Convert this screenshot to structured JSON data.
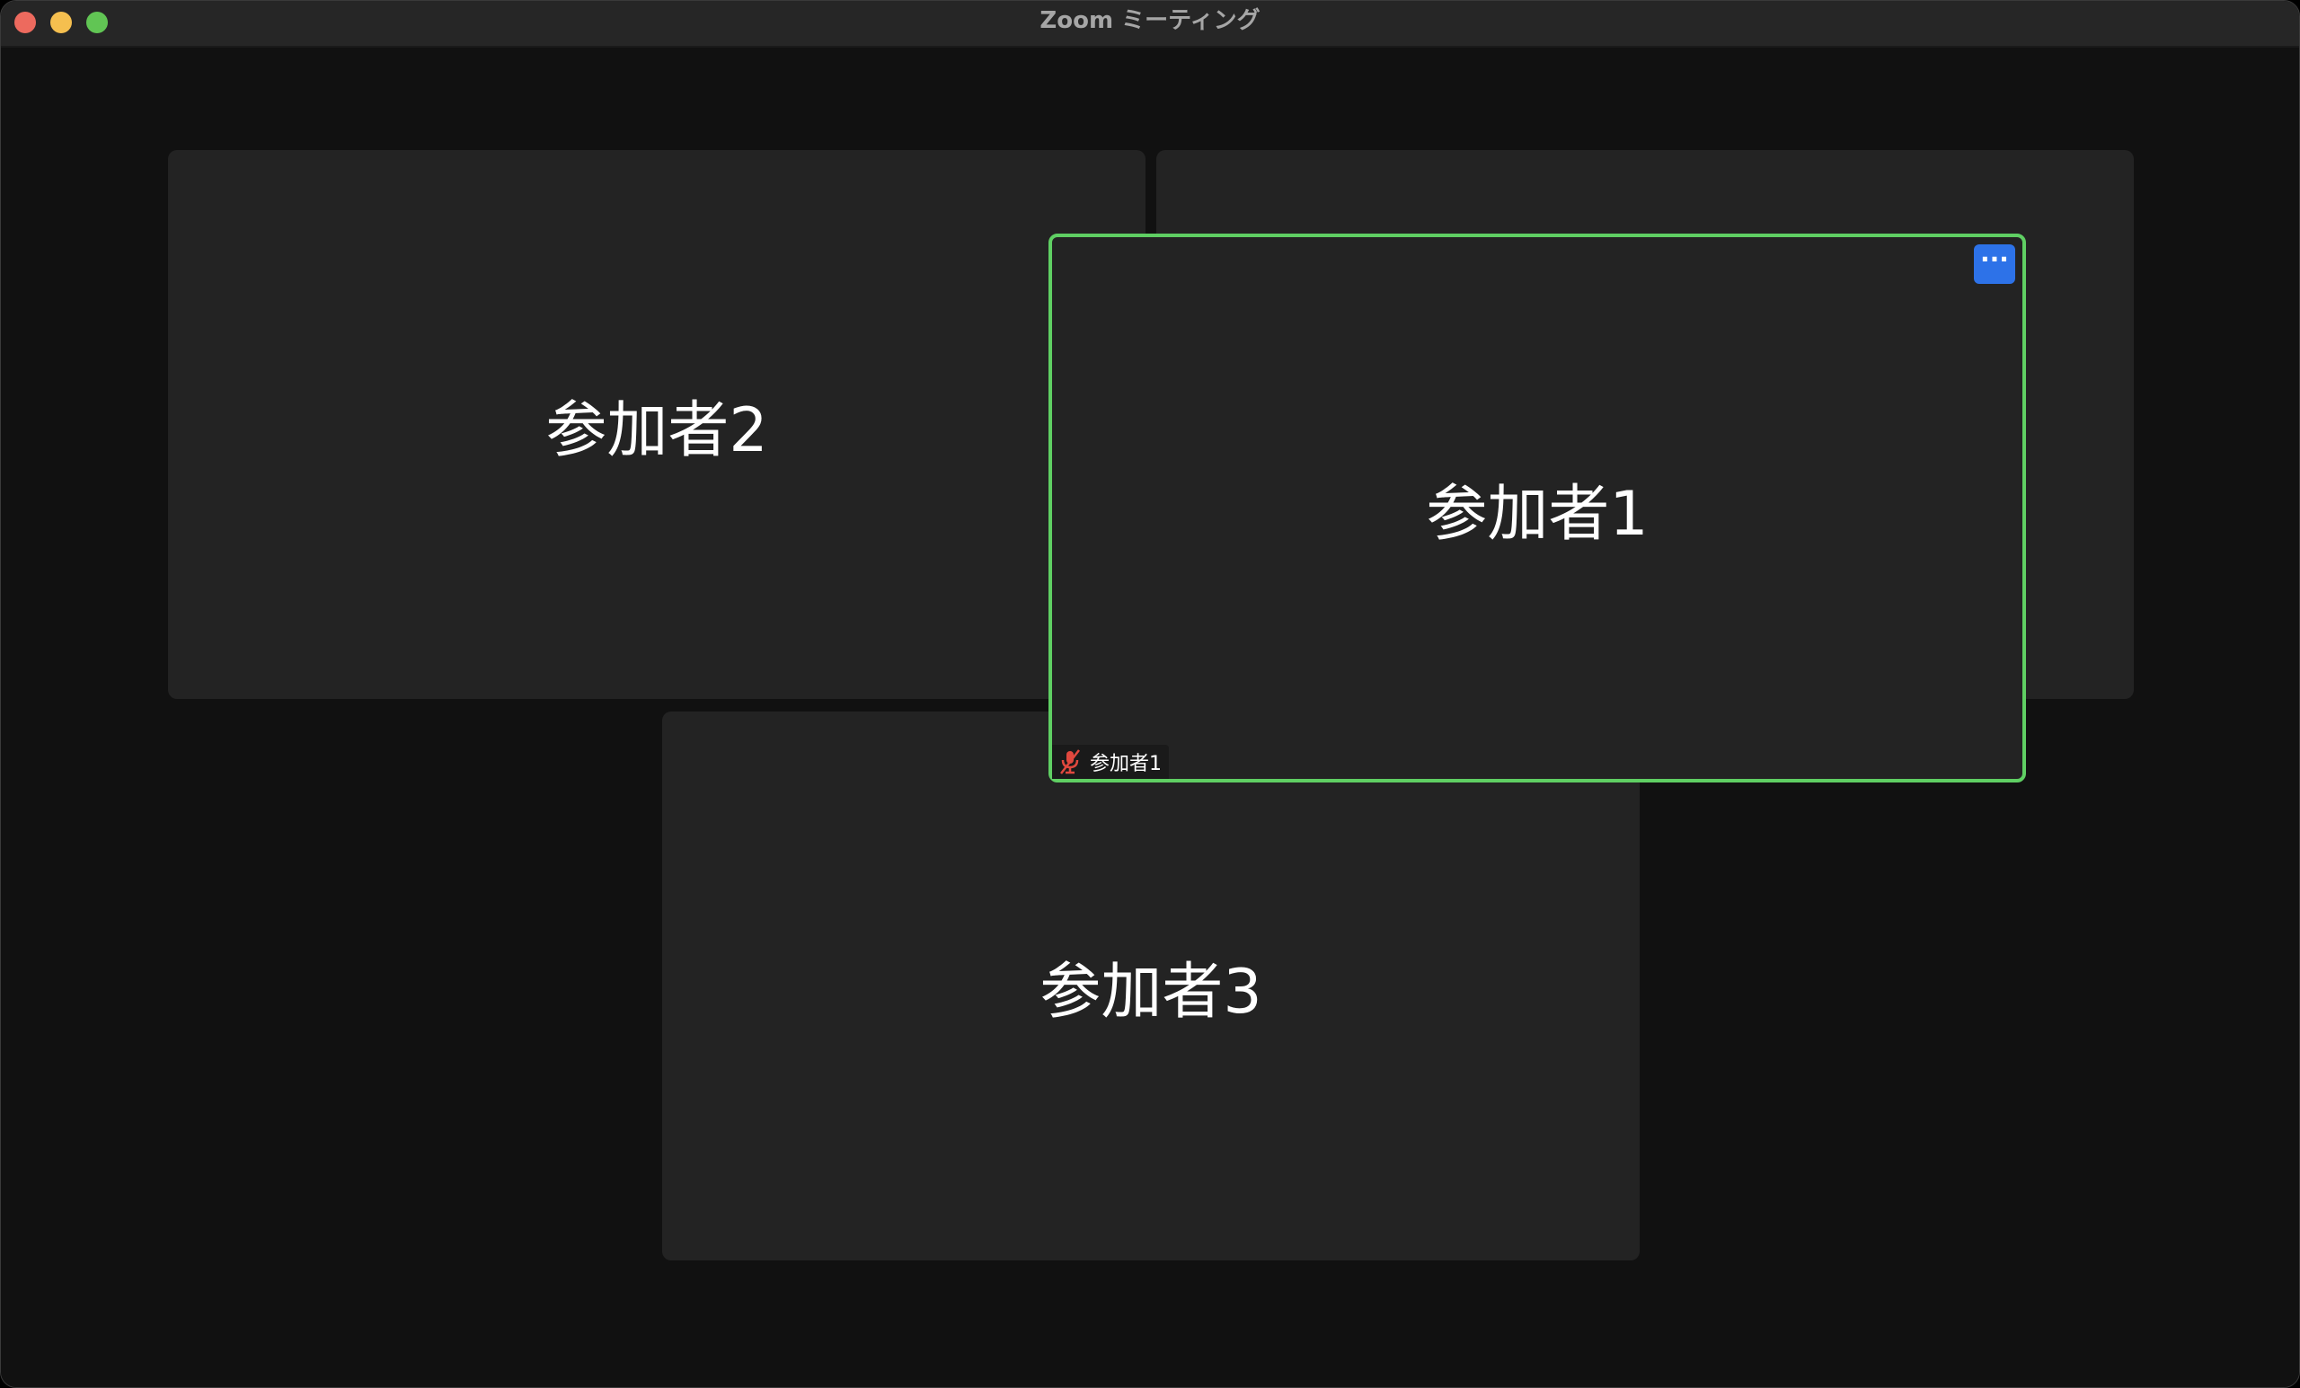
{
  "window": {
    "title": "Zoom ミーティング"
  },
  "participants": {
    "p1": {
      "name": "参加者1",
      "tag_label": "参加者1",
      "muted": true,
      "active_speaker": true
    },
    "p2": {
      "name": "参加者2"
    },
    "p3": {
      "name": "参加者3"
    }
  },
  "controls": {
    "more_label": "···"
  },
  "colors": {
    "active_border": "#5fcf63",
    "more_button": "#2d72e8",
    "muted_icon": "#e0483e"
  }
}
